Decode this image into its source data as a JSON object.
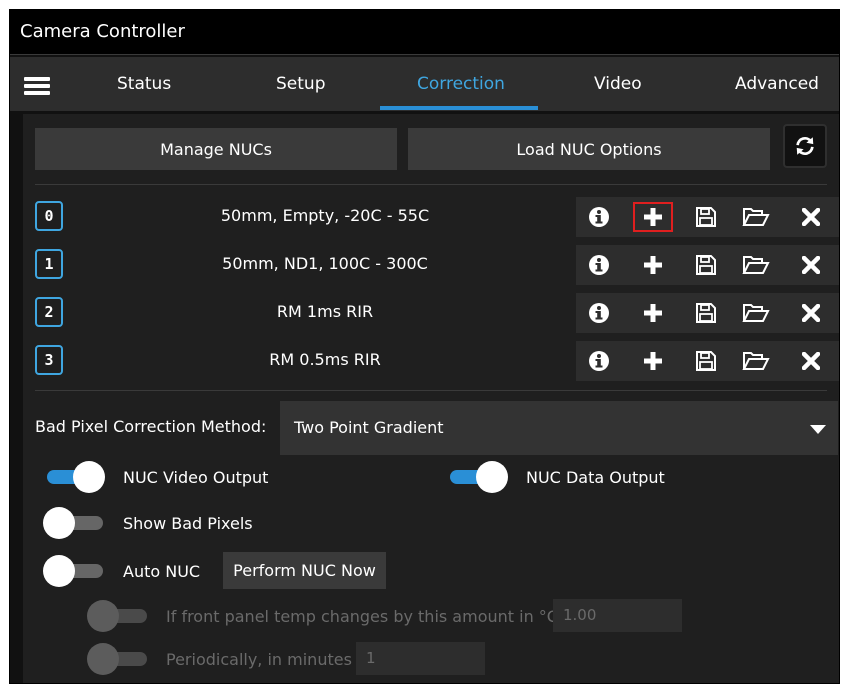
{
  "window": {
    "title": "Camera Controller"
  },
  "tabs": [
    {
      "label": "Status"
    },
    {
      "label": "Setup"
    },
    {
      "label": "Correction",
      "active": true
    },
    {
      "label": "Video"
    },
    {
      "label": "Advanced"
    }
  ],
  "toolbar": {
    "manage_label": "Manage NUCs",
    "load_label": "Load NUC Options",
    "refresh_icon": "refresh-icon"
  },
  "nucs": [
    {
      "index": "0",
      "name": "50mm, Empty, -20C - 55C"
    },
    {
      "index": "1",
      "name": "50mm, ND1, 100C - 300C"
    },
    {
      "index": "2",
      "name": "RM 1ms RIR"
    },
    {
      "index": "3",
      "name": "RM 0.5ms RIR"
    }
  ],
  "nuc_actions": [
    "info-icon",
    "plus-icon",
    "save-icon",
    "folder-open-icon",
    "close-icon"
  ],
  "bad_pixel": {
    "label": "Bad Pixel Correction Method:",
    "selected": "Two Point Gradient"
  },
  "toggles": {
    "nuc_video_output": {
      "label": "NUC Video Output",
      "on": true
    },
    "nuc_data_output": {
      "label": "NUC Data Output",
      "on": true
    },
    "show_bad_pixels": {
      "label": "Show Bad Pixels",
      "on": false
    },
    "auto_nuc": {
      "label": "Auto NUC",
      "on": false
    },
    "temp_change": {
      "label": "If front panel temp changes by this amount in °C",
      "on": false,
      "value": "1.00"
    },
    "periodically": {
      "label": "Periodically, in minutes",
      "on": false,
      "value": "1"
    }
  },
  "perform_nuc_label": "Perform NUC Now",
  "colors": {
    "accent": "#2a8fd6",
    "highlight": "#e01f1f",
    "background": "#1f1f1f"
  }
}
